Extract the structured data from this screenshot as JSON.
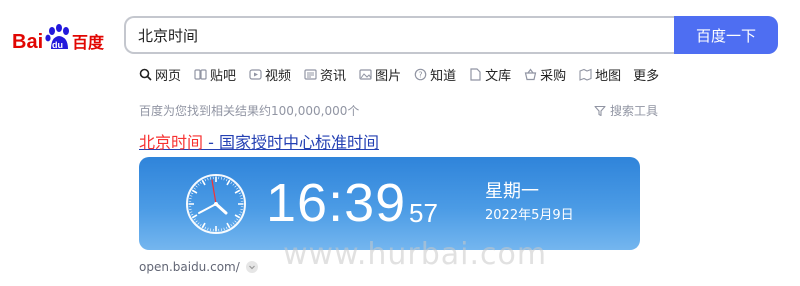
{
  "logo": {
    "text_bai": "Bai",
    "text_du": "du",
    "text_cn": "百度"
  },
  "search": {
    "value": "北京时间",
    "button_label": "百度一下"
  },
  "tabs": [
    {
      "label": "网页",
      "icon": "search-icon",
      "active": true
    },
    {
      "label": "贴吧",
      "icon": "tieba-icon"
    },
    {
      "label": "视频",
      "icon": "video-icon"
    },
    {
      "label": "资讯",
      "icon": "news-icon"
    },
    {
      "label": "图片",
      "icon": "image-icon"
    },
    {
      "label": "知道",
      "icon": "question-icon"
    },
    {
      "label": "文库",
      "icon": "document-icon"
    },
    {
      "label": "采购",
      "icon": "basket-icon"
    },
    {
      "label": "地图",
      "icon": "map-icon"
    },
    {
      "label": "更多",
      "icon": ""
    }
  ],
  "results": {
    "stats": "百度为您找到相关结果约100,000,000个",
    "filter_label": "搜索工具",
    "title_em": "北京时间",
    "title_rest": " - 国家授时中心标准时间",
    "url": "open.baidu.com/"
  },
  "clock_card": {
    "time": "16:39",
    "seconds": "57",
    "weekday": "星期一",
    "date": "2022年5月9日"
  },
  "watermark": "www.hurbai.com",
  "colors": {
    "accent": "#4e6ef2",
    "link": "#2440b3",
    "highlight": "#f73131",
    "logo_red": "#e10602",
    "logo_blue": "#2319dc"
  }
}
